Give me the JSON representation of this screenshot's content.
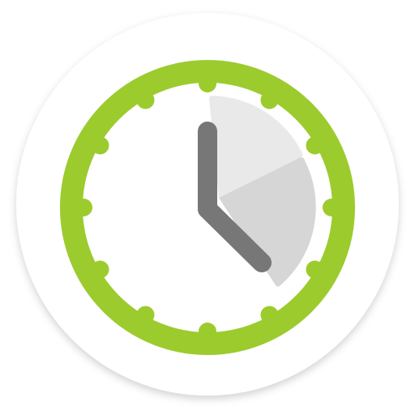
{
  "app_icon": {
    "icon": "timer-clock-icon",
    "colors": {
      "badge": "#ffffff",
      "badge_shadow": "#d9d9d9",
      "ring": "#9ccb2e",
      "face": "#ffffff",
      "hands": "#777777",
      "sector_light": "#e9e9e9",
      "sector_dark": "#d6d6d6"
    },
    "ticks": 12
  }
}
